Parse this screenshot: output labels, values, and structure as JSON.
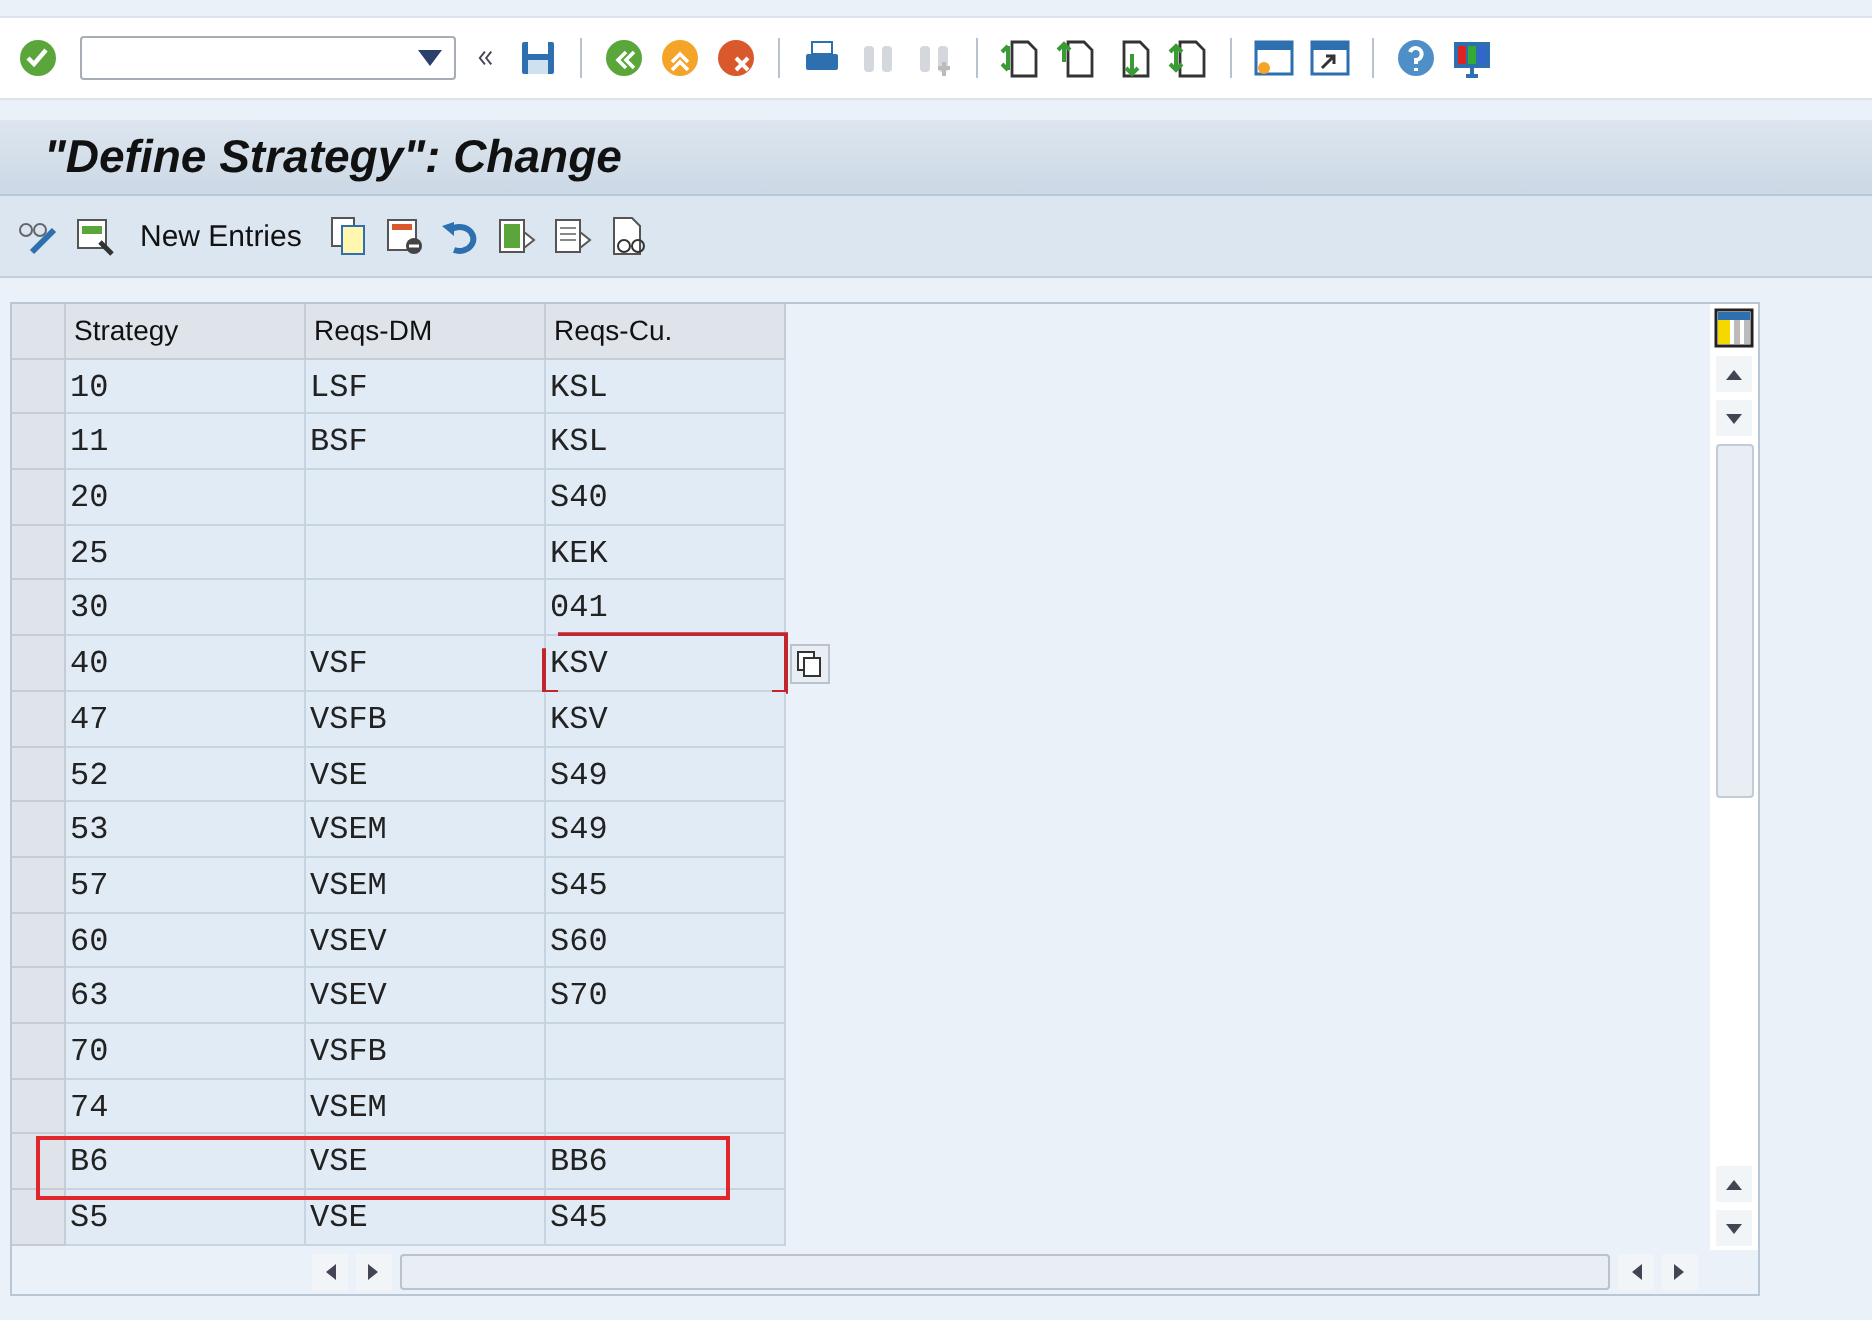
{
  "title": "\"Define Strategy\": Change",
  "app_toolbar": {
    "button": "New Entries"
  },
  "table": {
    "columns": [
      "Strategy",
      "Reqs-DM",
      "Reqs-Cu."
    ],
    "rows": [
      {
        "strategy": "10",
        "reqs_dm": "LSF",
        "reqs_cu": "KSL",
        "cu_focused": false,
        "marked": false
      },
      {
        "strategy": "11",
        "reqs_dm": "BSF",
        "reqs_cu": "KSL",
        "cu_focused": false,
        "marked": false
      },
      {
        "strategy": "20",
        "reqs_cu": "S40",
        "cu_focused": false,
        "marked": false
      },
      {
        "strategy": "25",
        "reqs_cu": "KEK",
        "cu_focused": false,
        "marked": false
      },
      {
        "strategy": "30",
        "reqs_cu": "041",
        "cu_focused": false,
        "marked": false
      },
      {
        "strategy": "40",
        "reqs_dm": "VSF",
        "reqs_cu": "KSV",
        "cu_focused": true,
        "marked": false
      },
      {
        "strategy": "47",
        "reqs_dm": "VSFB",
        "reqs_cu": "KSV",
        "cu_focused": false,
        "marked": false
      },
      {
        "strategy": "52",
        "reqs_dm": "VSE",
        "reqs_cu": "S49",
        "cu_focused": false,
        "marked": false
      },
      {
        "strategy": "53",
        "reqs_dm": "VSEM",
        "reqs_cu": "S49",
        "cu_focused": false,
        "marked": false
      },
      {
        "strategy": "57",
        "reqs_dm": "VSEM",
        "reqs_cu": "S45",
        "cu_focused": false,
        "marked": false
      },
      {
        "strategy": "60",
        "reqs_dm": "VSEV",
        "reqs_cu": "S60",
        "cu_focused": false,
        "marked": false
      },
      {
        "strategy": "63",
        "reqs_dm": "VSEV",
        "reqs_cu": "S70",
        "cu_focused": false,
        "marked": false
      },
      {
        "strategy": "70",
        "reqs_dm": "VSFB",
        "cu_focused": false,
        "marked": false
      },
      {
        "strategy": "74",
        "reqs_dm": "VSEM",
        "cu_focused": false,
        "marked": false
      },
      {
        "strategy": "B6",
        "reqs_dm": "VSE",
        "reqs_cu": "BB6",
        "cu_focused": false,
        "marked": true
      },
      {
        "strategy": "S5",
        "reqs_dm": "VSE",
        "reqs_cu": "S45",
        "cu_focused": false,
        "marked": false
      }
    ]
  }
}
